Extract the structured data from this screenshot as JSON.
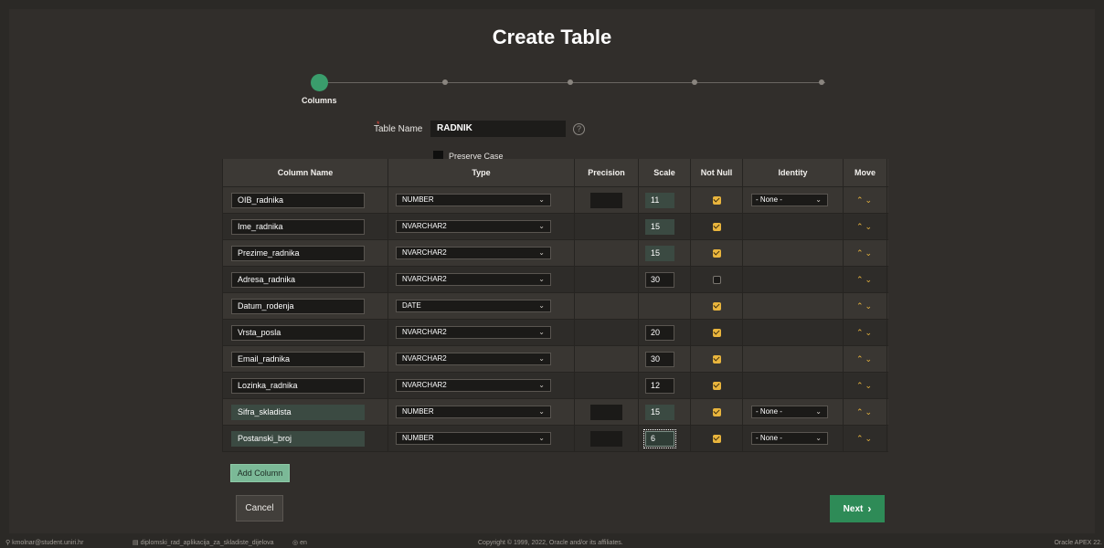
{
  "page": {
    "title": "Create Table"
  },
  "wizard": {
    "active_label": "Columns",
    "steps_total": 5
  },
  "form": {
    "table_name_label": "Table Name",
    "table_name_value": "RADNIK",
    "help_glyph": "?",
    "preserve_case_label": "Preserve Case",
    "preserve_case_checked": false
  },
  "grid": {
    "headers": [
      "Column Name",
      "Type",
      "Precision",
      "Scale",
      "Not Null",
      "Identity",
      "Move"
    ],
    "rows": [
      {
        "name": "OIB_radnika",
        "type": "NUMBER",
        "precision": "",
        "scale": "11",
        "not_null": true,
        "identity": "- None -",
        "has_precision": true,
        "has_identity": true
      },
      {
        "name": "Ime_radnika",
        "type": "NVARCHAR2",
        "precision": "",
        "scale": "15",
        "not_null": true,
        "identity": "",
        "has_precision": false,
        "has_identity": false
      },
      {
        "name": "Prezime_radnika",
        "type": "NVARCHAR2",
        "precision": "",
        "scale": "15",
        "not_null": true,
        "identity": "",
        "has_precision": false,
        "has_identity": false
      },
      {
        "name": "Adresa_radnika",
        "type": "NVARCHAR2",
        "precision": "",
        "scale": "30",
        "not_null": false,
        "identity": "",
        "has_precision": false,
        "has_identity": false
      },
      {
        "name": "Datum_rodenja",
        "type": "DATE",
        "precision": "",
        "scale": "",
        "not_null": true,
        "identity": "",
        "has_precision": false,
        "has_identity": false
      },
      {
        "name": "Vrsta_posla",
        "type": "NVARCHAR2",
        "precision": "",
        "scale": "20",
        "not_null": true,
        "identity": "",
        "has_precision": false,
        "has_identity": false
      },
      {
        "name": "Email_radnika",
        "type": "NVARCHAR2",
        "precision": "",
        "scale": "30",
        "not_null": true,
        "identity": "",
        "has_precision": false,
        "has_identity": false
      },
      {
        "name": "Lozinka_radnika",
        "type": "NVARCHAR2",
        "precision": "",
        "scale": "12",
        "not_null": true,
        "identity": "",
        "has_precision": false,
        "has_identity": false
      },
      {
        "name": "Sifra_skladista",
        "type": "NUMBER",
        "precision": "",
        "scale": "15",
        "not_null": true,
        "identity": "- None -",
        "has_precision": true,
        "has_identity": true
      },
      {
        "name": "Postanski_broj",
        "type": "NUMBER",
        "precision": "",
        "scale": "6",
        "not_null": true,
        "identity": "- None -",
        "has_precision": true,
        "has_identity": true
      }
    ]
  },
  "buttons": {
    "add_column": "Add Column",
    "cancel": "Cancel",
    "next": "Next",
    "next_glyph": "›"
  },
  "footer": {
    "user": "kmolnar@student.uniri.hr",
    "workspace": "diplomski_rad_aplikacija_za_skladiste_dijelova",
    "language": "en",
    "copyright": "Copyright © 1999, 2022, Oracle and/or its affiliates.",
    "version": "Oracle APEX 22."
  },
  "icons": {
    "user": "user-icon",
    "workspace": "database-icon",
    "language": "globe-icon",
    "select": "chevron-down-icon",
    "move": "chevron-up-down-icon",
    "help": "help-icon"
  },
  "colors": {
    "accent_green": "#2e8b57",
    "checkbox_yellow": "#e9b53d",
    "wizard_active": "#3a9d6c"
  }
}
